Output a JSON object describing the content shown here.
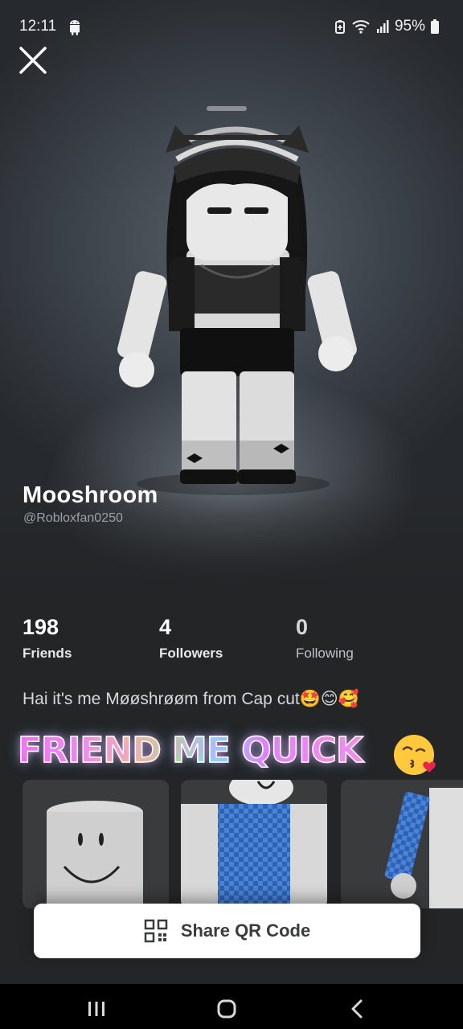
{
  "status_bar": {
    "time": "12:11",
    "battery": "95%"
  },
  "profile": {
    "display_name": "Mooshroom",
    "username": "@Robloxfan0250"
  },
  "stats": [
    {
      "value": "198",
      "label": "Friends"
    },
    {
      "value": "4",
      "label": "Followers"
    },
    {
      "value": "0",
      "label": "Following"
    }
  ],
  "about": {
    "text": "Hai it's me Møøshrøøm from Cap cut🤩😊🥰"
  },
  "overlay": {
    "text": "FRIEND ME QUICK",
    "emoji_icon": "kissing-face-icon"
  },
  "share": {
    "label": "Share QR Code",
    "icon": "qr-code-icon"
  },
  "nav": {
    "recents_icon": "recents-icon",
    "home_icon": "home-icon",
    "back_icon": "back-icon"
  },
  "colors": {
    "background": "#232527",
    "card": "#393b3d",
    "share_button": "#ffffff",
    "muted_text": "#9da1a8"
  }
}
